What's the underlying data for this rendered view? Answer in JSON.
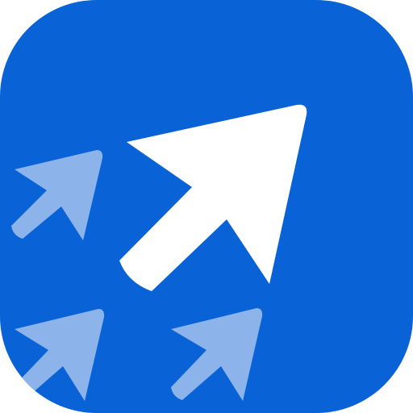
{
  "icon": {
    "name": "app-icon",
    "glyph": "arrow-up-right-icon",
    "colors": {
      "background": "#0a63d6",
      "main_arrow": "#ffffff",
      "small_arrows": "#8db4ea",
      "page": "#ffffff"
    }
  }
}
